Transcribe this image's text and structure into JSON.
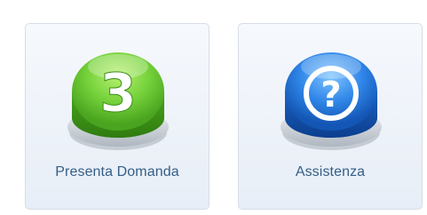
{
  "tiles": [
    {
      "label": "Presenta Domanda",
      "icon": "number-3-green-button-icon",
      "icon_text": "3",
      "color": "#5fc63e"
    },
    {
      "label": "Assistenza",
      "icon": "question-mark-blue-button-icon",
      "icon_text": "?",
      "color": "#1f74d6"
    }
  ]
}
